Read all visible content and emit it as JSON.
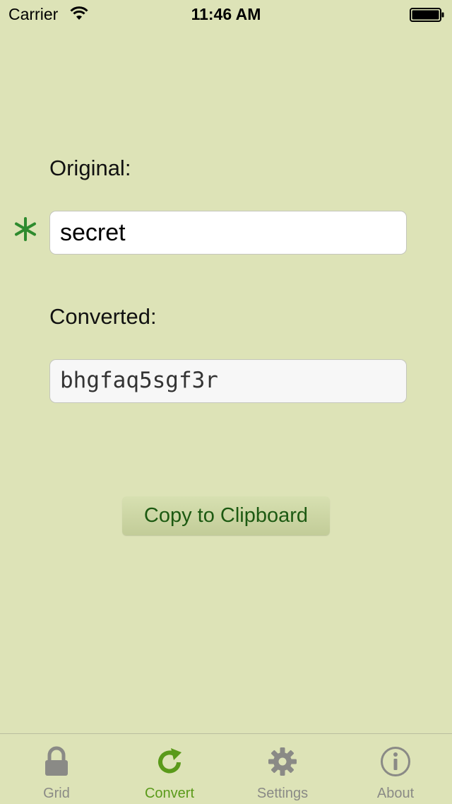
{
  "status_bar": {
    "carrier": "Carrier",
    "time": "11:46 AM",
    "icons": [
      "wifi-icon",
      "battery-icon"
    ]
  },
  "form": {
    "original_label": "Original:",
    "original_value": "secret",
    "converted_label": "Converted:",
    "converted_value": "bhgfaq5sgf3r",
    "marker_icon": "asterisk-icon",
    "copy_button_label": "Copy to Clipboard"
  },
  "tab_bar": {
    "active_tab": "Convert",
    "tabs": [
      {
        "label": "Grid",
        "icon": "lock-icon"
      },
      {
        "label": "Convert",
        "icon": "refresh-arrow-icon"
      },
      {
        "label": "Settings",
        "icon": "gear-icon"
      },
      {
        "label": "About",
        "icon": "info-icon"
      }
    ]
  },
  "colors": {
    "background": "#dde3b7",
    "accent_green": "#5a9a1a",
    "asterisk_green": "#2e8b2e",
    "button_text": "#1d5a12",
    "inactive_tab": "#8a8a86"
  }
}
